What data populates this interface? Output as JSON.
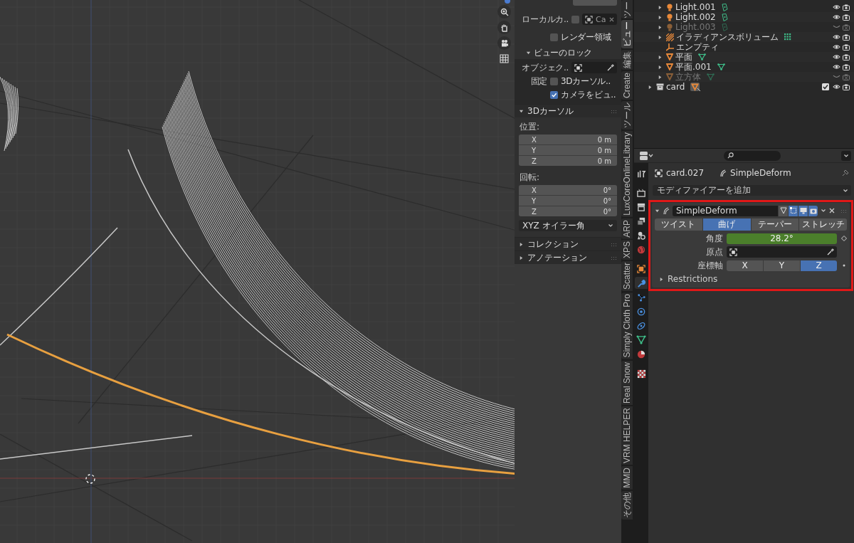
{
  "sidebar": {
    "local_camera": {
      "label": "ローカルカ..",
      "checked": false,
      "object": "Ca"
    },
    "render_region": {
      "label": "レンダー領域",
      "checked": false
    },
    "view_lock": {
      "title": "ビューのロック",
      "expanded": true,
      "object_label": "オブジェク..",
      "lock_label": "固定",
      "lock_cursor": {
        "label": "3Dカーソル..",
        "checked": false
      },
      "lock_camera": {
        "label": "カメラをビュ..",
        "checked": true
      }
    },
    "cursor_panel": {
      "title": "3Dカーソル",
      "expanded": true,
      "location_label": "位置:",
      "location": [
        {
          "axis": "X",
          "value": "0 m"
        },
        {
          "axis": "Y",
          "value": "0 m"
        },
        {
          "axis": "Z",
          "value": "0 m"
        }
      ],
      "rotation_label": "回転:",
      "rotation": [
        {
          "axis": "X",
          "value": "0°"
        },
        {
          "axis": "Y",
          "value": "0°"
        },
        {
          "axis": "Z",
          "value": "0°"
        }
      ],
      "rotation_mode": "XYZ オイラー角"
    },
    "other_panels": [
      {
        "title": "コレクション",
        "expanded": false
      },
      {
        "title": "アノテーション",
        "expanded": false
      }
    ]
  },
  "sidebar_tabs": [
    {
      "label": "ツー",
      "selected": false
    },
    {
      "label": "ビュー",
      "selected": true
    },
    {
      "label": "編集",
      "selected": false
    },
    {
      "label": "Create",
      "selected": false
    },
    {
      "label": "ツール",
      "selected": false
    },
    {
      "label": "LuxCoreOnlineLibrary",
      "selected": false
    },
    {
      "label": "ARP",
      "selected": false
    },
    {
      "label": "XPS",
      "selected": false
    },
    {
      "label": "Scatter",
      "selected": false
    },
    {
      "label": "Simply Cloth Pro",
      "selected": false
    },
    {
      "label": "Real Snow",
      "selected": false
    },
    {
      "label": "VRM HELPER",
      "selected": false
    },
    {
      "label": "MMD",
      "selected": false
    },
    {
      "label": "その他",
      "selected": false
    }
  ],
  "outliner": {
    "items": [
      {
        "children": [
          {
            "name": "Light.001",
            "kind": "light",
            "expandable": true,
            "hidden": false
          },
          {
            "name": "Light.002",
            "kind": "light",
            "expandable": true,
            "hidden": false
          },
          {
            "name": "Light.003",
            "kind": "light",
            "expandable": true,
            "hidden": true
          },
          {
            "name": "イラディアンスボリューム",
            "kind": "probe",
            "expandable": true,
            "hidden": false
          },
          {
            "name": "エンプティ",
            "kind": "empty",
            "expandable": false,
            "hidden": false
          },
          {
            "name": "平面",
            "kind": "mesh",
            "expandable": true,
            "hidden": false
          },
          {
            "name": "平面.001",
            "kind": "mesh",
            "expandable": true,
            "hidden": false
          },
          {
            "name": "立方体",
            "kind": "mesh",
            "expandable": true,
            "hidden": true
          }
        ]
      },
      {
        "name": "card",
        "kind": "collection",
        "expandable": true,
        "hidden": false,
        "included": true
      }
    ]
  },
  "properties": {
    "tabs": [
      {
        "kind": "tool",
        "selected": false
      },
      {
        "kind": "render",
        "selected": false
      },
      {
        "kind": "output",
        "selected": false
      },
      {
        "kind": "view_layer",
        "selected": false
      },
      {
        "kind": "scene",
        "selected": false
      },
      {
        "kind": "world",
        "selected": false
      },
      {
        "kind": "object",
        "selected": false
      },
      {
        "kind": "modifier",
        "selected": true
      },
      {
        "kind": "particles",
        "selected": false
      },
      {
        "kind": "physics",
        "selected": false
      },
      {
        "kind": "constraints",
        "selected": false
      },
      {
        "kind": "data",
        "selected": false
      },
      {
        "kind": "material",
        "selected": false
      },
      {
        "kind": "texture",
        "selected": false
      }
    ],
    "breadcrumb": {
      "object": "card.027",
      "modifier": "SimpleDeform"
    },
    "add_modifier": "モディファイアーを追加",
    "modifier": {
      "name": "SimpleDeform",
      "expanded": true,
      "show_in_editmode": false,
      "show_on_cage": true,
      "show_viewport": true,
      "show_render": true,
      "modes": [
        {
          "label": "ツイスト",
          "selected": false
        },
        {
          "label": "曲げ",
          "selected": true
        },
        {
          "label": "テーパー",
          "selected": false
        },
        {
          "label": "ストレッチ",
          "selected": false
        }
      ],
      "angle": {
        "label": "角度",
        "value": "28.2°"
      },
      "origin": {
        "label": "原点"
      },
      "axis": {
        "label": "座標軸",
        "options": [
          {
            "label": "X",
            "selected": false
          },
          {
            "label": "Y",
            "selected": false
          },
          {
            "label": "Z",
            "selected": true
          }
        ]
      },
      "restrictions": {
        "label": "Restrictions",
        "expanded": false
      }
    }
  }
}
